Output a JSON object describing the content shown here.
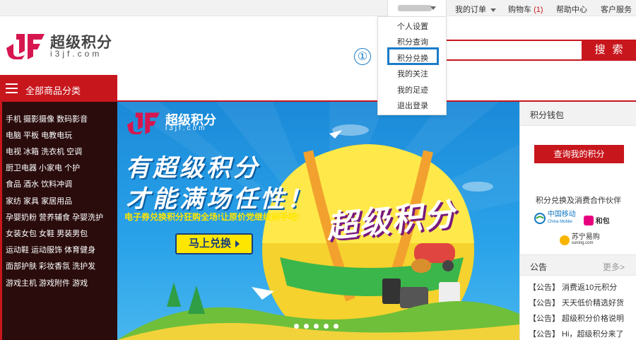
{
  "topbar": {
    "my_orders": "我的订单",
    "cart_label": "购物车",
    "cart_count": "(1)",
    "help": "帮助中心",
    "service": "客户服务"
  },
  "user_menu": {
    "items": [
      "个人设置",
      "积分查询",
      "积分兑换",
      "我的关注",
      "我的足迹",
      "退出登录"
    ],
    "selected_index": 2
  },
  "annotation_marker": "①",
  "logo": {
    "name": "超级积分",
    "domain": "i3jf.com"
  },
  "search": {
    "button_label": "搜索",
    "value": "",
    "placeholder": ""
  },
  "category_nav": {
    "title": "全部商品分类",
    "items": [
      "手机 摄影摄像 数码影音",
      "电脑 平板 电教电玩",
      "电视 冰箱 洗衣机 空调",
      "厨卫电器 小家电 个护",
      "食品 酒水 饮料冲调",
      "家纺 家具 家居用品",
      "孕婴奶粉 营养辅食 孕婴洗护",
      "女装女包 女鞋 男装男包",
      "运动鞋 运动服饰 体育健身",
      "面部护肤 彩妆香氛 洗护发",
      "游戏主机 游戏附件 游戏"
    ]
  },
  "banner": {
    "logo_name": "超级积分",
    "logo_domain": "i3jf.com",
    "headline_1": "有超级积分",
    "headline_2": "才能满场任性！",
    "subtitle": "电子券兑换积分狂购全场!让原价党继续剁手吧!",
    "button_label": "马上兑换",
    "balloon_text": "超级积分",
    "slide_count": 5,
    "active_slide": 0
  },
  "wallet_panel": {
    "title": "积分钱包",
    "query_button": "查询我的积分",
    "partners_title": "积分兑换及消费合作伙伴",
    "partners": [
      "中国移动",
      "China Mobile",
      "和包",
      "苏宁易购",
      "suning.com"
    ]
  },
  "notices": {
    "title": "公告",
    "more": "更多>",
    "items": [
      "【公告】 消费返10元积分",
      "【公告】 天天低价精选好货",
      "【公告】 超级积分价格说明",
      "【公告】 Hi，超级积分来了"
    ]
  },
  "colors": {
    "brand_red": "#c8161d",
    "highlight_blue": "#1a7bc8",
    "category_bg": "#2a0c0c"
  }
}
